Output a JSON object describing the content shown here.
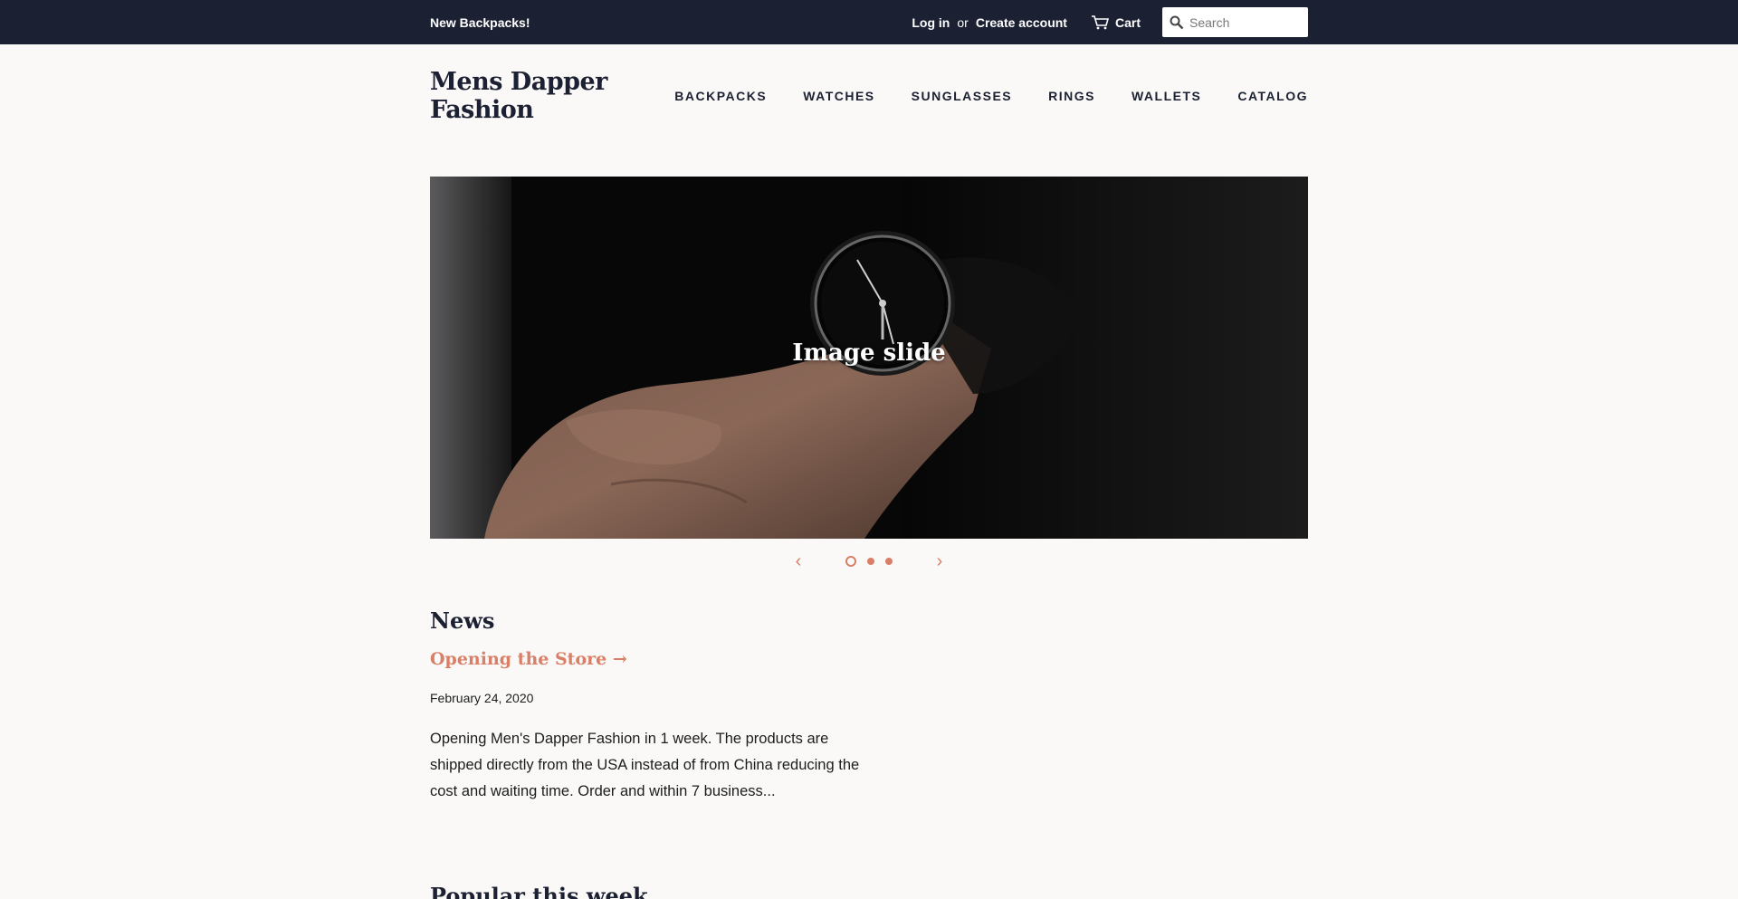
{
  "topbar": {
    "announcement": "New Backpacks!",
    "login_label": "Log in",
    "or_text": "or",
    "create_account_label": "Create account",
    "cart_label": "Cart",
    "search_placeholder": "Search"
  },
  "header": {
    "logo": "Mens Dapper Fashion",
    "nav": [
      "BACKPACKS",
      "WATCHES",
      "SUNGLASSES",
      "RINGS",
      "WALLETS",
      "CATALOG"
    ]
  },
  "hero": {
    "title": "Image slide",
    "slide_count": 3,
    "active_slide": 1,
    "prev_icon": "chevron-left-icon",
    "next_icon": "chevron-right-icon"
  },
  "news": {
    "heading": "News",
    "article": {
      "title": "Opening the Store →",
      "date": "February 24, 2020",
      "excerpt": "Opening Men's Dapper Fashion in 1 week.  The products are shipped directly from the USA instead of from China reducing the cost and waiting time. Order and within 7 business..."
    }
  },
  "popular": {
    "heading": "Popular this week"
  },
  "colors": {
    "topbar_bg": "#1b2033",
    "accent": "#d97f67",
    "page_bg": "#faf9f7"
  }
}
